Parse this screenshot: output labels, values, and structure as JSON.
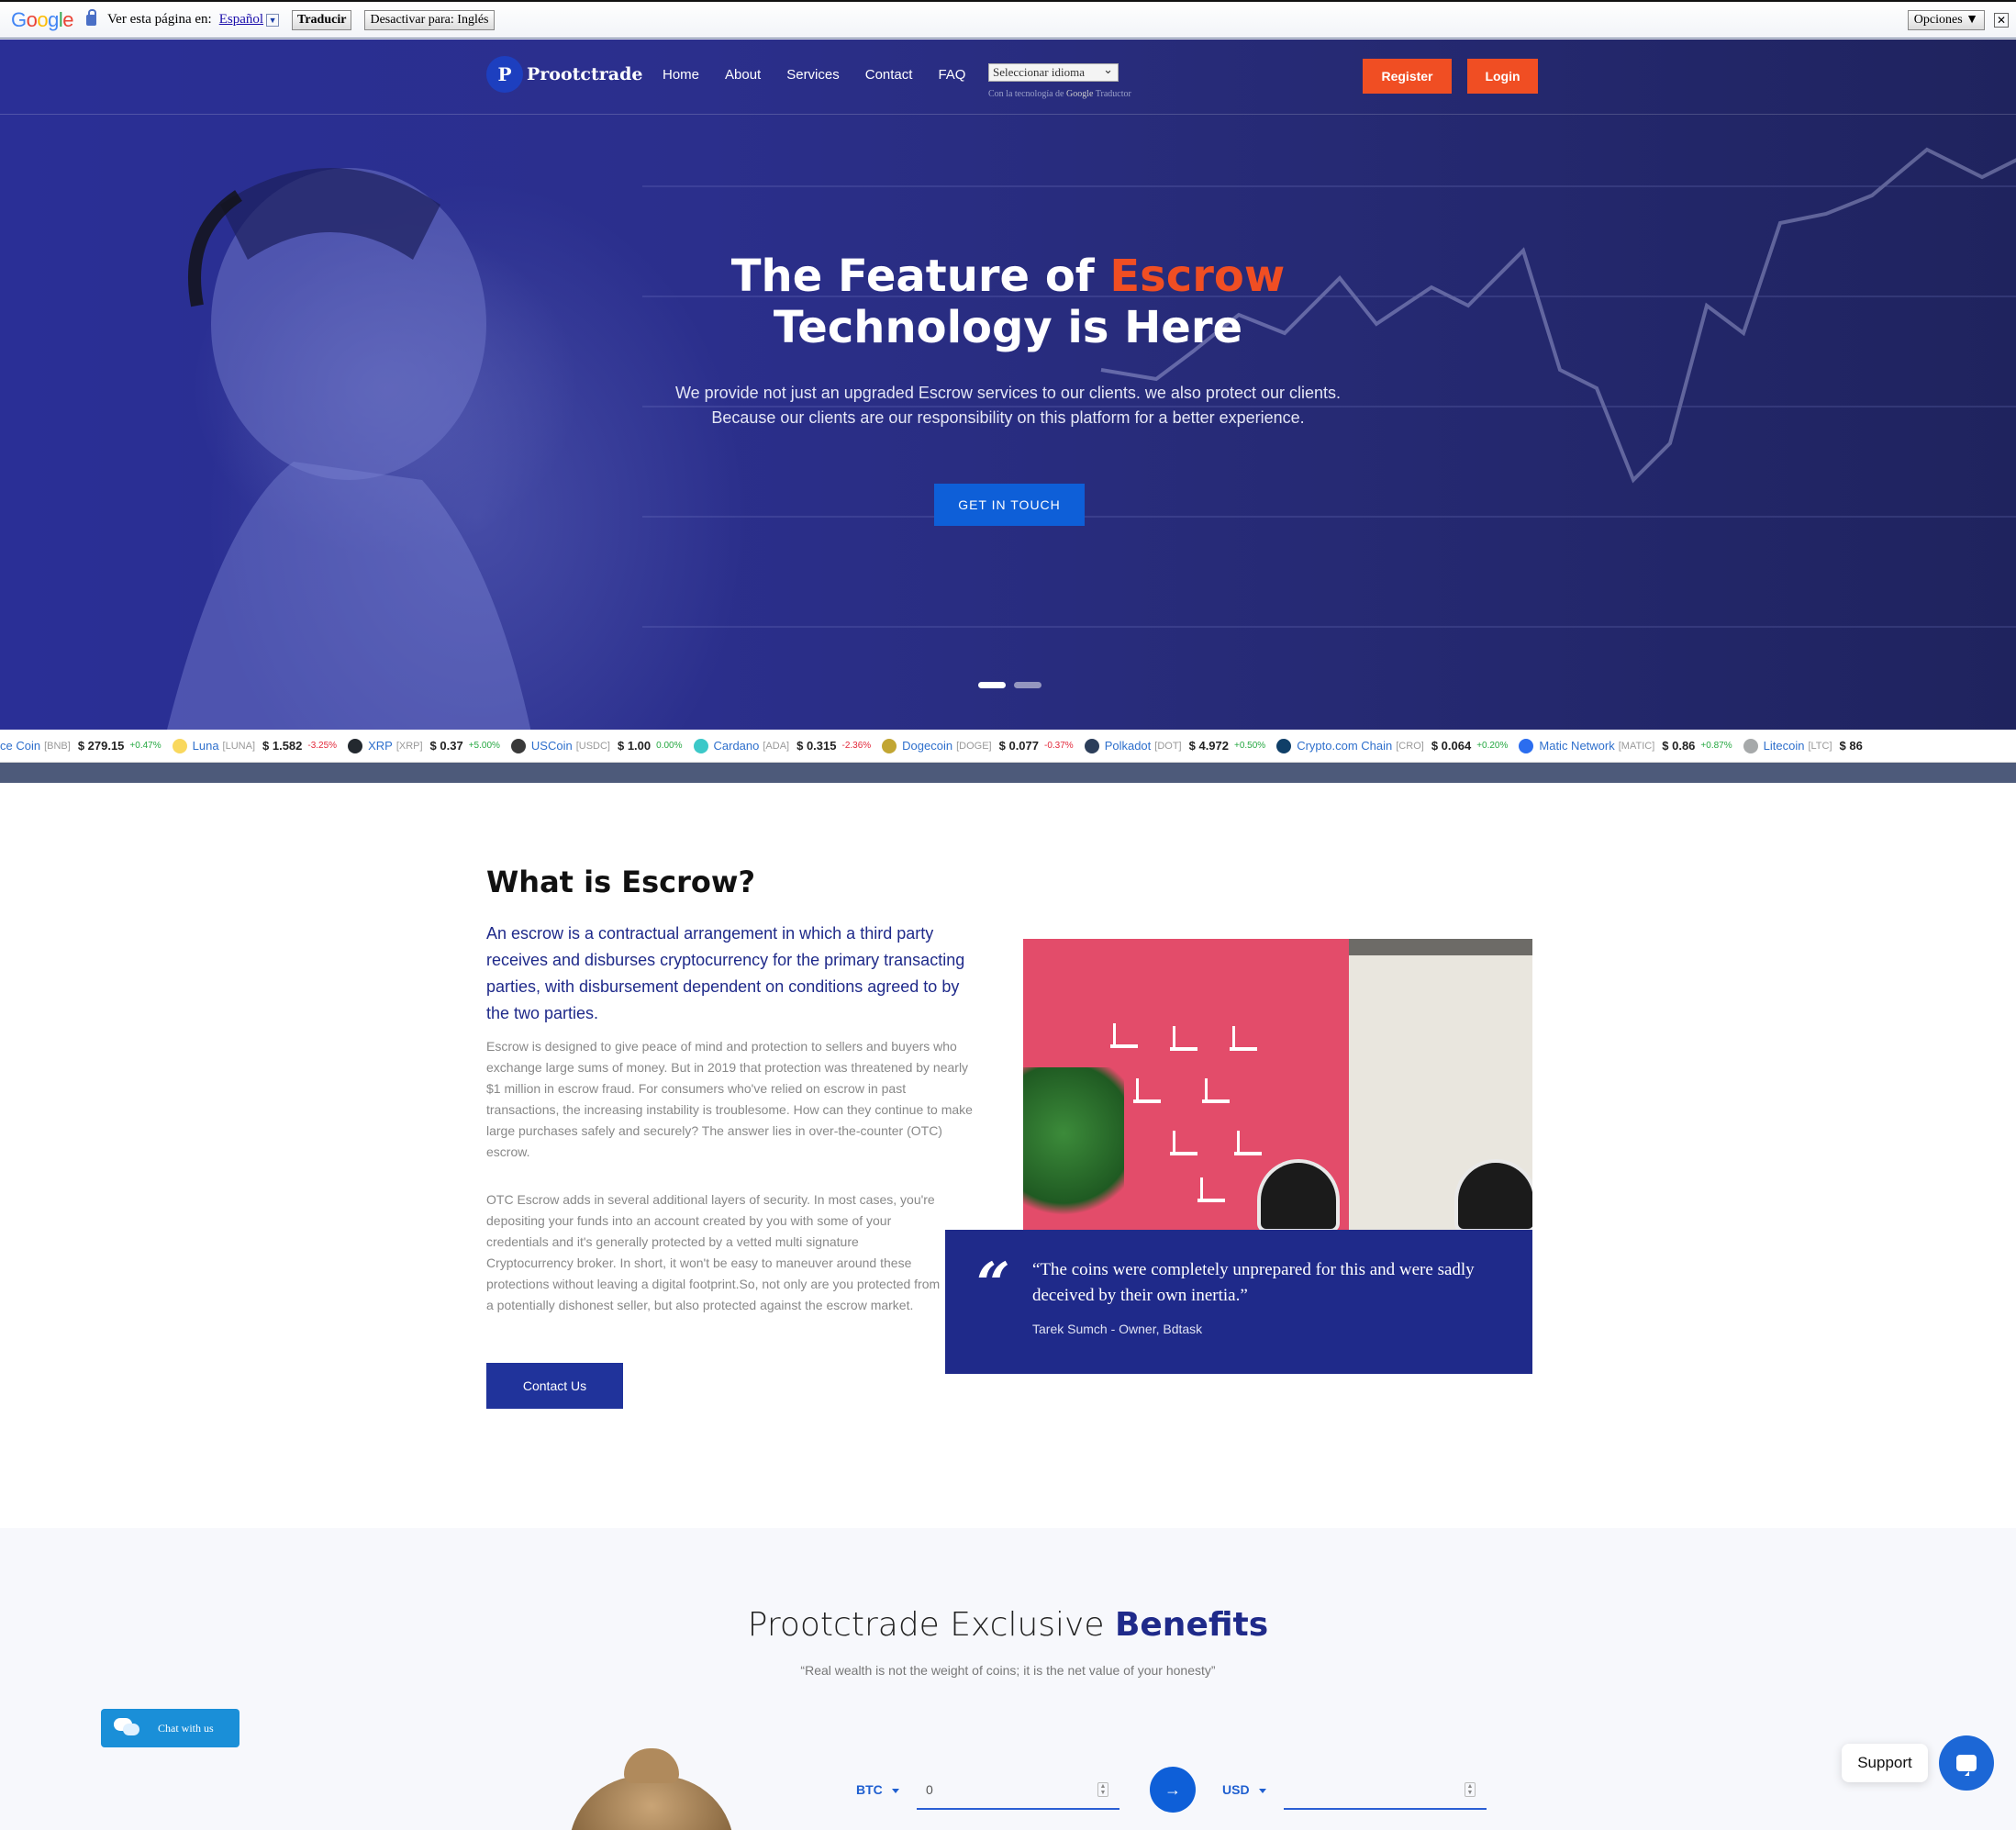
{
  "translate_bar": {
    "logo": "Google",
    "prompt": "Ver esta página en:",
    "language": "Español",
    "translate_label": "Traducir",
    "disable_label": "Desactivar para: Inglés",
    "options_label": "Opciones ▼",
    "close": "✕"
  },
  "header": {
    "brand": "Prootctrade",
    "nav": [
      "Home",
      "About",
      "Services",
      "Contact",
      "FAQ"
    ],
    "language_select": "Seleccionar idioma",
    "powered_prefix": "Con la tecnología de",
    "powered_google": "Google",
    "powered_suffix": "Traductor",
    "register_label": "Register",
    "login_label": "Login"
  },
  "hero": {
    "title_part1": "The Feature of ",
    "title_accent": "Escrow",
    "title_line2": "Technology is Here",
    "subtitle_line1": "We provide not just an upgraded Escrow services to our clients. we also protect our clients.",
    "subtitle_line2": "Because our clients are our responsibility on this platform for a better experience.",
    "cta_label": "GET IN TOUCH"
  },
  "ticker": [
    {
      "name": "ce Coin",
      "symbol": "[BNB]",
      "price": "$ 279.15",
      "change": "+0.47%",
      "dir": "up",
      "color": "#f3ba2f"
    },
    {
      "name": "Luna",
      "symbol": "[LUNA]",
      "price": "$ 1.582",
      "change": "-3.25%",
      "dir": "down",
      "color": "#f9d85e"
    },
    {
      "name": "XRP",
      "symbol": "[XRP]",
      "price": "$ 0.37",
      "change": "+5.00%",
      "dir": "up",
      "color": "#23292f"
    },
    {
      "name": "USCoin",
      "symbol": "[USDC]",
      "price": "$ 1.00",
      "change": "0.00%",
      "dir": "up",
      "color": "#3a3a3a"
    },
    {
      "name": "Cardano",
      "symbol": "[ADA]",
      "price": "$ 0.315",
      "change": "-2.36%",
      "dir": "down",
      "color": "#3cc8c8"
    },
    {
      "name": "Dogecoin",
      "symbol": "[DOGE]",
      "price": "$ 0.077",
      "change": "-0.37%",
      "dir": "down",
      "color": "#c2a633"
    },
    {
      "name": "Polkadot",
      "symbol": "[DOT]",
      "price": "$ 4.972",
      "change": "+0.50%",
      "dir": "up",
      "color": "#2c3e5a"
    },
    {
      "name": "Crypto.com Chain",
      "symbol": "[CRO]",
      "price": "$ 0.064",
      "change": "+0.20%",
      "dir": "up",
      "color": "#103f68"
    },
    {
      "name": "Matic Network",
      "symbol": "[MATIC]",
      "price": "$ 0.86",
      "change": "+0.87%",
      "dir": "up",
      "color": "#2b6def"
    },
    {
      "name": "Litecoin",
      "symbol": "[LTC]",
      "price": "$ 86",
      "change": "",
      "dir": "up",
      "color": "#a6a9aa"
    }
  ],
  "escrow": {
    "heading": "What is Escrow?",
    "lead": "An escrow is a contractual arrangement in which a third party receives and disburses cryptocurrency for the primary transacting parties, with disbursement dependent on conditions agreed to by the two parties.",
    "para1": "Escrow is designed to give peace of mind and protection to sellers and buyers who exchange large sums of money. But in 2019 that protection was threatened by nearly $1 million in escrow fraud. For consumers who've relied on escrow in past transactions, the increasing instability is troublesome. How can they continue to make large purchases safely and securely? The answer lies in over-the-counter (OTC) escrow.",
    "para2": "OTC Escrow adds in several additional layers of security. In most cases, you're depositing your funds into an account created by you with some of your credentials and it's generally protected by a vetted multi signature Cryptocurrency broker. In short, it won't be easy to maneuver around these protections without leaving a digital footprint.So, not only are you protected from a potentially dishonest seller, but also protected against the escrow market.",
    "contact_label": "Contact Us",
    "quote_mark": "“",
    "quote": "“The coins were completely unprepared for this and were sadly deceived by their own inertia.”",
    "quote_author": "Tarek Sumch - Owner, Bdtask"
  },
  "benefits": {
    "title_plain": "Prootctrade Exclusive ",
    "title_bold": "Benefits",
    "subtitle": "“Real wealth is not the weight of coins; it is the net value of your honesty”"
  },
  "converter": {
    "from_currency": "BTC",
    "from_value": "0",
    "to_currency": "USD",
    "to_value": "",
    "arrow": "→"
  },
  "chat": {
    "label": "Chat with us"
  },
  "support": {
    "label": "Support"
  }
}
